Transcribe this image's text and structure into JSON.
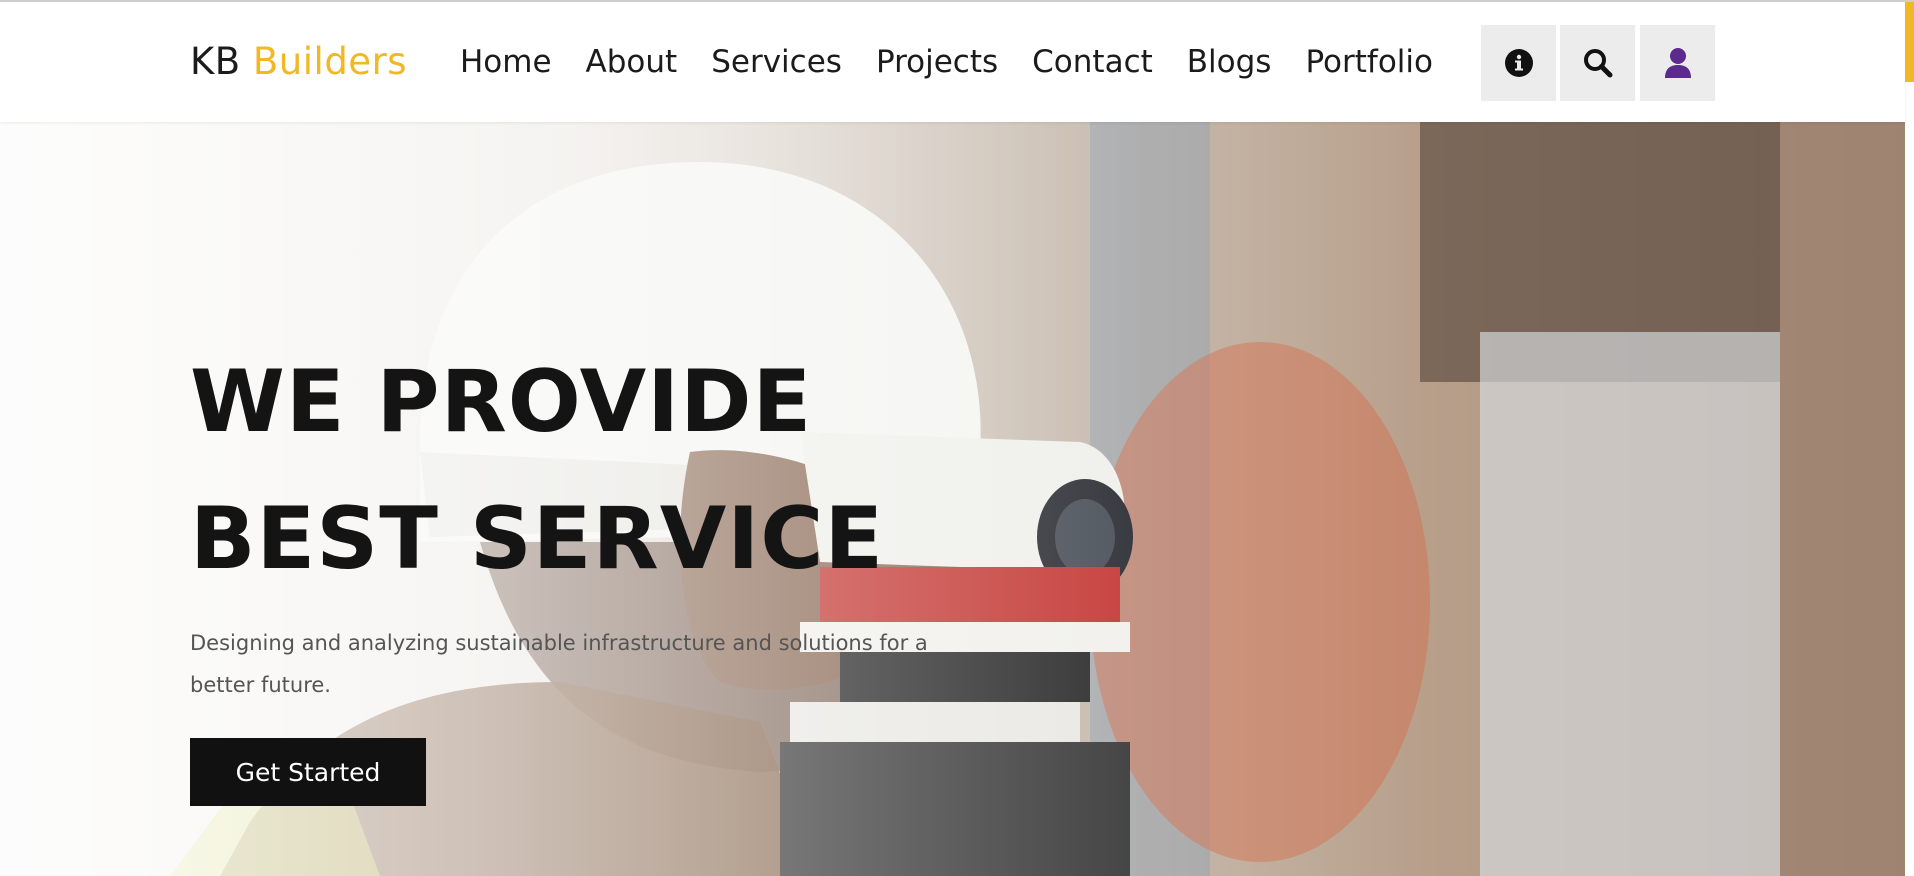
{
  "header": {
    "logo": {
      "prefix": "KB",
      "brand": "Builders"
    },
    "nav": [
      {
        "label": "Home"
      },
      {
        "label": "About"
      },
      {
        "label": "Services"
      },
      {
        "label": "Projects"
      },
      {
        "label": "Contact"
      },
      {
        "label": "Blogs"
      },
      {
        "label": "Portfolio"
      }
    ],
    "icons": {
      "info": "info-circle-icon",
      "search": "search-icon",
      "user": "user-icon"
    }
  },
  "hero": {
    "title_line1": "WE PROVIDE",
    "title_line2": "BEST SERVICE",
    "subtitle": "Designing and analyzing sustainable infrastructure and solutions for a better future.",
    "cta_label": "Get Started"
  },
  "colors": {
    "accent": "#f2b824",
    "text_dark": "#141414",
    "user_icon": "#5b2a8c",
    "button_bg": "#111111",
    "icon_button_bg": "#ececec"
  }
}
